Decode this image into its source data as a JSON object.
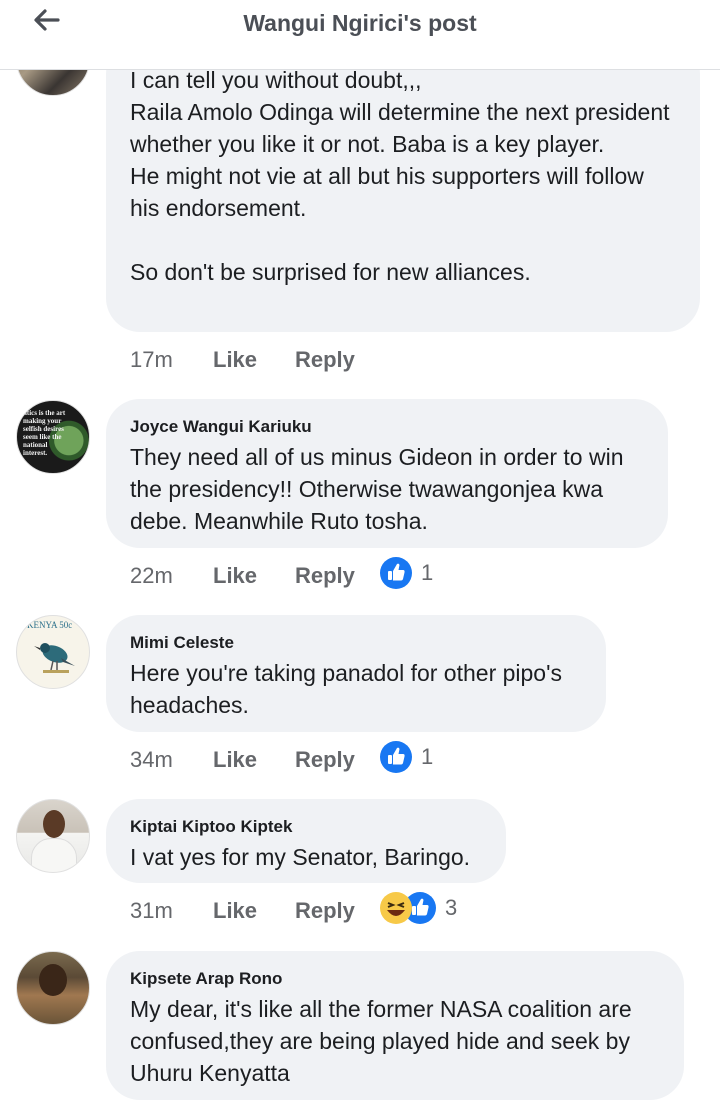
{
  "header": {
    "title": "Wangui Ngirici's post"
  },
  "comments": [
    {
      "author": "",
      "text": "I can tell you without doubt,,,\nRaila Amolo Odinga will determine the next president whether you like it or not. Baba is a key player.\nHe might not vie at all but his supporters will follow his endorsement.\n\nSo don't be surprised for new alliances.",
      "time": "17m",
      "like": "Like",
      "reply": "Reply",
      "reactions": ""
    },
    {
      "author": "Joyce Wangui Kariuku",
      "avatar_text": "litics is the art making your selfish desires seem like the national interest.",
      "text": "They need all of us minus Gideon in order to win the presidency!! Otherwise twawangonjea kwa debe. Meanwhile Ruto tosha.",
      "time": "22m",
      "like": "Like",
      "reply": "Reply",
      "reactions": "1"
    },
    {
      "author": "Mimi Celeste",
      "avatar_text": "KENYA 50c",
      "text": "Here you're taking panadol for other pipo's headaches.",
      "time": "34m",
      "like": "Like",
      "reply": "Reply",
      "reactions": "1"
    },
    {
      "author": "Kiptai Kiptoo Kiptek",
      "text": "I vat yes for my Senator, Baringo.",
      "time": "31m",
      "like": "Like",
      "reply": "Reply",
      "reactions": "3"
    },
    {
      "author": "Kipsete Arap Rono",
      "text": "My dear, it's like all the former NASA coalition are confused,they are being played hide and seek by Uhuru Kenyatta",
      "time": "",
      "like": "",
      "reply": "",
      "reactions": ""
    }
  ],
  "colors": {
    "like_blue": "#1877f2",
    "bubble": "#f0f2f5",
    "meta": "#65676b"
  },
  "icons": {
    "back": "back-arrow-icon",
    "like": "like-thumb-icon",
    "haha": "haha-emoji-icon"
  }
}
